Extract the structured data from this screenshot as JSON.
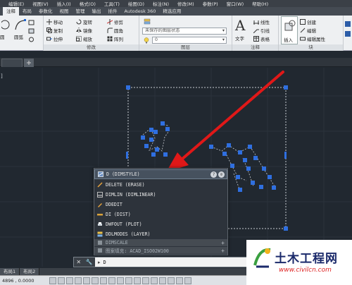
{
  "menubar": {
    "items": [
      "编辑(E)",
      "视图(V)",
      "插入(I)",
      "格式(O)",
      "工具(T)",
      "绘图(D)",
      "标注(N)",
      "修改(M)",
      "参数(P)",
      "窗口(W)",
      "帮助(H)"
    ]
  },
  "ribbon_tabs": [
    "注释",
    "布局",
    "参数化",
    "视图",
    "管理",
    "输出",
    "插件",
    "Autodesk 360",
    "精选应用"
  ],
  "ribbon": {
    "draw_group": {
      "btn_circle": "圆",
      "btn_arc": "圆弧"
    },
    "modify_group": {
      "title": "修改",
      "move": "移动",
      "rotate": "旋转",
      "trim": "修剪",
      "copy": "复制",
      "mirror": "镜像",
      "fillet": "圆角",
      "stretch": "拉伸",
      "scale": "缩放",
      "array": "阵列"
    },
    "layer_group": {
      "title": "图层",
      "layer_state": "未保存的图层状态",
      "current_layer": "0"
    },
    "annotation_group": {
      "title": "注释",
      "text": "文字",
      "linear": "线性",
      "leader": "引线",
      "table": "表格"
    },
    "block_group": {
      "title": "块",
      "insert": "插入",
      "create": "创建",
      "edit": "编辑",
      "edit_attributes": "编辑属性"
    }
  },
  "left_axis_label": "]",
  "autocomplete": {
    "items": [
      {
        "text": "D (DIMSTYLE)",
        "selected": true
      },
      {
        "text": "DELETE (ERASE)",
        "selected": false
      },
      {
        "text": "DIMLIN (DIMLINEAR)",
        "selected": false
      },
      {
        "text": "DDEDIT",
        "selected": false
      },
      {
        "text": "DI (DIST)",
        "selected": false
      },
      {
        "text": "DWFOUT (PLOT)",
        "selected": false
      },
      {
        "text": "DDLMODES (LAYER)",
        "selected": false
      }
    ],
    "sections": [
      {
        "text": "DIMSCALE"
      },
      {
        "text": "图案填充: ACAD_ISO02W100"
      }
    ]
  },
  "command_line": {
    "value": "D"
  },
  "layout_tabs": [
    "布局1",
    "布局2"
  ],
  "status": {
    "coords": "4896 , 0.0000"
  },
  "watermark": {
    "brand": "土木工程网",
    "url": "www.civilcn.com"
  },
  "colors": {
    "background": "#212830",
    "grip": "#2f6fe0",
    "arrow": "#e01818",
    "highlight": "#46515e"
  }
}
